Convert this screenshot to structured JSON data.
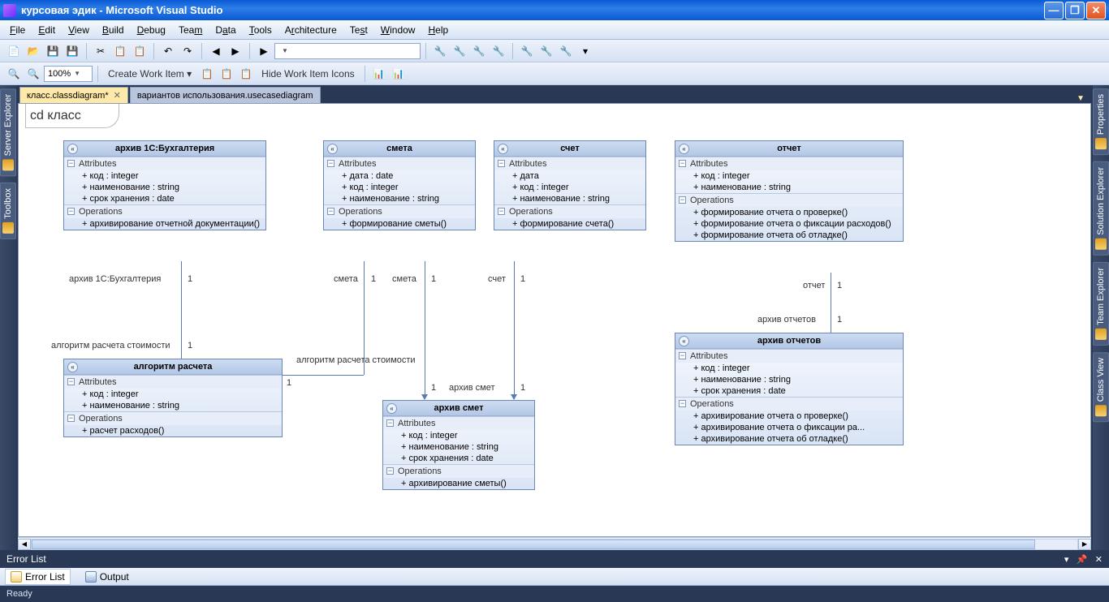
{
  "window": {
    "title": "курсовая эдик - Microsoft Visual Studio"
  },
  "menu": [
    "File",
    "Edit",
    "View",
    "Build",
    "Debug",
    "Team",
    "Data",
    "Tools",
    "Architecture",
    "Test",
    "Window",
    "Help"
  ],
  "toolbar2": {
    "zoom": "100%",
    "workitem": "Create Work Item",
    "hide_icons": "Hide Work Item Icons"
  },
  "tabs": {
    "active": "класс.classdiagram*",
    "inactive": "вариантов использования.usecasediagram"
  },
  "diagram": {
    "title": "cd класс",
    "section_attr": "Attributes",
    "section_op": "Operations",
    "classes": {
      "archive1c": {
        "name": "архив 1С:Бухгалтерия",
        "attrs": [
          "+ код : integer",
          "+ наименование : string",
          "+ срок хранения : date"
        ],
        "ops": [
          "+ архивирование отчетной документации()"
        ]
      },
      "smeta": {
        "name": "смета",
        "attrs": [
          "+ дата : date",
          "+ код : integer",
          "+ наименование : string"
        ],
        "ops": [
          "+ формирование сметы()"
        ]
      },
      "schet": {
        "name": "счет",
        "attrs": [
          "+ дата",
          "+ код : integer",
          "+ наименование : string"
        ],
        "ops": [
          "+ формирование счета()"
        ]
      },
      "otchet": {
        "name": "отчет",
        "attrs": [
          "+ код : integer",
          "+ наименование : string"
        ],
        "ops": [
          "+ формирование отчета о проверке()",
          "+ формирование отчета о фиксации расходов()",
          "+ формирование отчета об отладке()"
        ]
      },
      "algoritm": {
        "name": "алгоритм расчета",
        "attrs": [
          "+ код : integer",
          "+ наименование : string"
        ],
        "ops": [
          "+ расчет расходов()"
        ]
      },
      "arhiv_smet": {
        "name": "архив смет",
        "attrs": [
          "+ код : integer",
          "+ наименование : string",
          "+ срок хранения : date"
        ],
        "ops": [
          "+ архивирование сметы()"
        ]
      },
      "arhiv_otchetov": {
        "name": "архив отчетов",
        "attrs": [
          "+ код : integer",
          "+ наименование : string",
          "+ срок хранения : date"
        ],
        "ops": [
          "+ архивирование отчета о проверке()",
          "+ архивирование отчета о фиксации ра...",
          "+ архивирование отчета об отладке()"
        ]
      }
    },
    "assoc": {
      "a1": {
        "role": "архив 1С:Бухгалтерия",
        "mult": "1"
      },
      "a2": {
        "role": "алгоритм расчета стоимости",
        "mult": "1"
      },
      "a3": {
        "role": "смета",
        "mult": "1"
      },
      "a4": {
        "role": "смета",
        "mult": "1"
      },
      "a5": {
        "role": "алгоритм расчета стоимости"
      },
      "a6": {
        "role": "счет",
        "mult": "1"
      },
      "a7": {
        "role": "архив смет",
        "mult": "1"
      },
      "a8": {
        "mult": "1"
      },
      "a9": {
        "role": "отчет",
        "mult": "1"
      },
      "a10": {
        "role": "архив отчетов",
        "mult": "1"
      }
    }
  },
  "left_tabs": [
    "Server Explorer",
    "Toolbox"
  ],
  "right_tabs": [
    "Properties",
    "Solution Explorer",
    "Team Explorer",
    "Class View"
  ],
  "bottom": {
    "panel_title": "Error List",
    "tab_error": "Error List",
    "tab_output": "Output"
  },
  "status": "Ready"
}
